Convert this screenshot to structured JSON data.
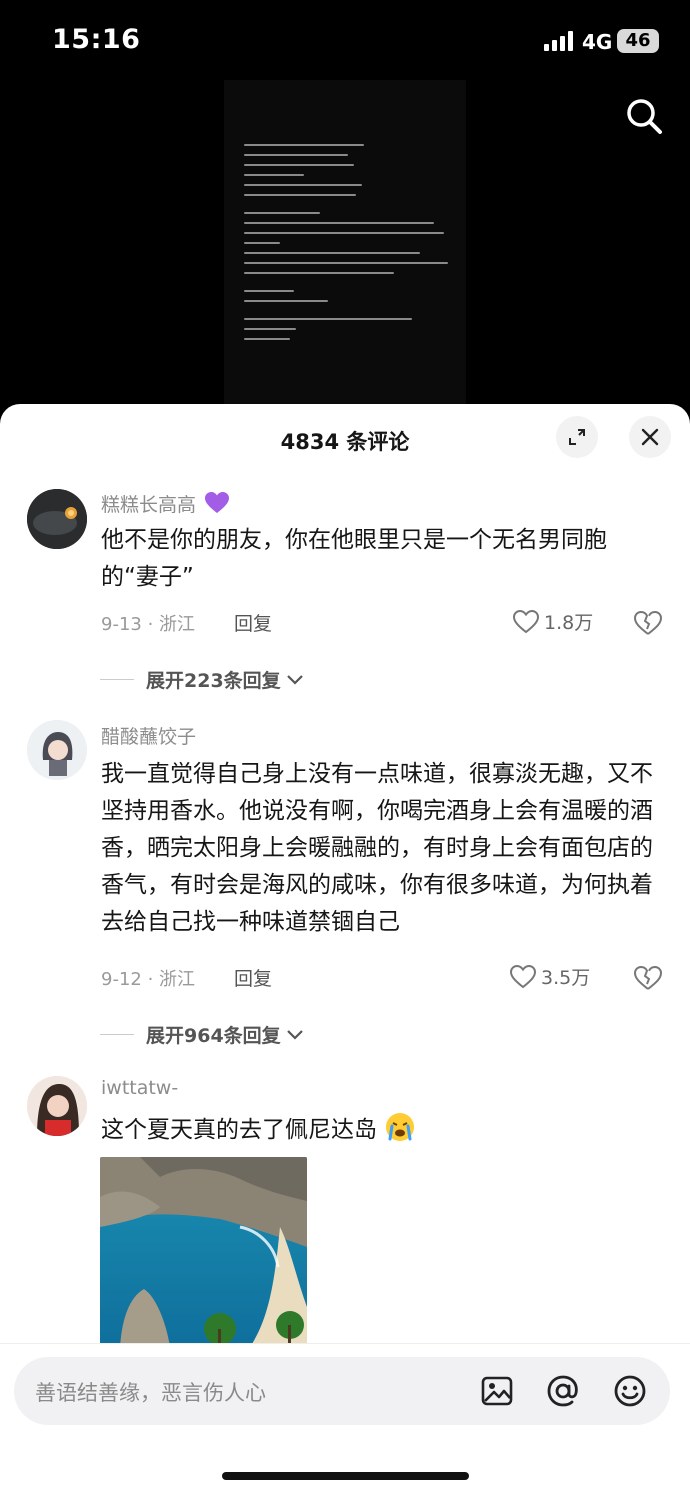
{
  "status_bar": {
    "time": "15:16",
    "network": "4G",
    "battery": "46"
  },
  "sheet": {
    "title": "4834 条评论"
  },
  "comments": [
    {
      "username": "糕糕长高高",
      "badge_icon": "purple-heart",
      "text": "他不是你的朋友，你在他眼里只是一个无名男同胞的“妻子”",
      "meta": "9-13 · 浙江",
      "reply": "回复",
      "likes": "1.8万",
      "expand": "展开223条回复"
    },
    {
      "username": "醋酸蘸饺子",
      "text": "我一直觉得自己身上没有一点味道，很寡淡无趣，又不坚持用香水。他说没有啊，你喝完酒身上会有温暖的酒香，晒完太阳身上会暖融融的，有时身上会有面包店的香气，有时会是海风的咸味，你有很多味道，为何执着去给自己找一种味道禁锢自己",
      "meta": "9-12 · 浙江",
      "reply": "回复",
      "likes": "3.5万",
      "expand": "展开964条回复"
    },
    {
      "username": "iwttatw-",
      "text": "这个夏天真的去了佩尼达岛",
      "emoji_icon": "crying-face"
    }
  ],
  "input": {
    "placeholder": "善语结善缘，恶言伤人心"
  },
  "colors": {
    "sheet_bg": "#ffffff",
    "text_primary": "#161616",
    "text_secondary": "#8c8c8c",
    "badge": "#a25ce6"
  }
}
